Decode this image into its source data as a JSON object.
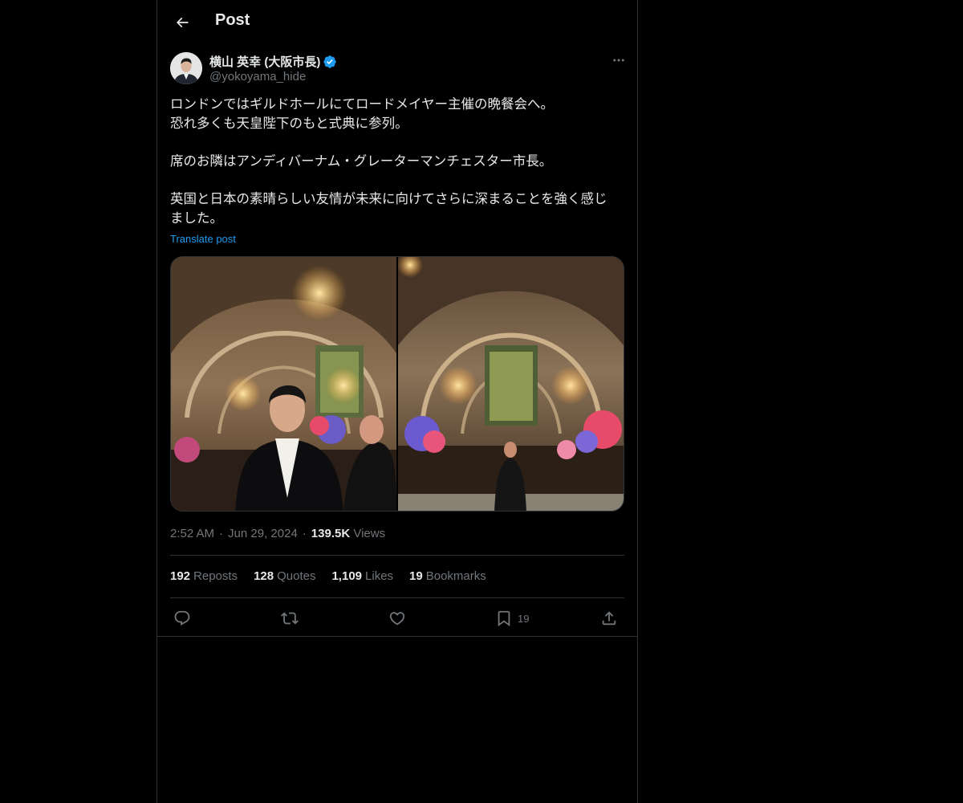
{
  "topbar": {
    "title": "Post"
  },
  "author": {
    "name": "横山 英幸 (大阪市長)",
    "handle": "@yokoyama_hide"
  },
  "post": {
    "lines": [
      "ロンドンではギルドホールにてロードメイヤー主催の晩餐会へ。",
      "恐れ多くも天皇陛下のもと式典に参列。",
      "席のお隣はアンディバーナム・グレーターマンチェスター市長。",
      "英国と日本の素晴らしい友情が未来に向けてさらに深まることを強く感じ",
      "ました。"
    ],
    "translate_label": "Translate post"
  },
  "meta": {
    "time": "2:52 AM",
    "date": "Jun 29, 2024",
    "views_count": "139.5K",
    "views_label": "Views"
  },
  "stats": {
    "reposts_count": "192",
    "reposts_label": "Reposts",
    "quotes_count": "128",
    "quotes_label": "Quotes",
    "likes_count": "1,109",
    "likes_label": "Likes",
    "bookmarks_count": "19",
    "bookmarks_label": "Bookmarks"
  },
  "actions": {
    "bookmark_count": "19"
  },
  "colors": {
    "background": "#000000",
    "text": "#e7e9ea",
    "muted": "#71767b",
    "accent": "#1d9bf0",
    "border": "#2f3336"
  },
  "icons": [
    "back-arrow-icon",
    "verified-badge-icon",
    "more-icon",
    "reply-icon",
    "repost-icon",
    "like-icon",
    "bookmark-icon",
    "share-icon"
  ]
}
